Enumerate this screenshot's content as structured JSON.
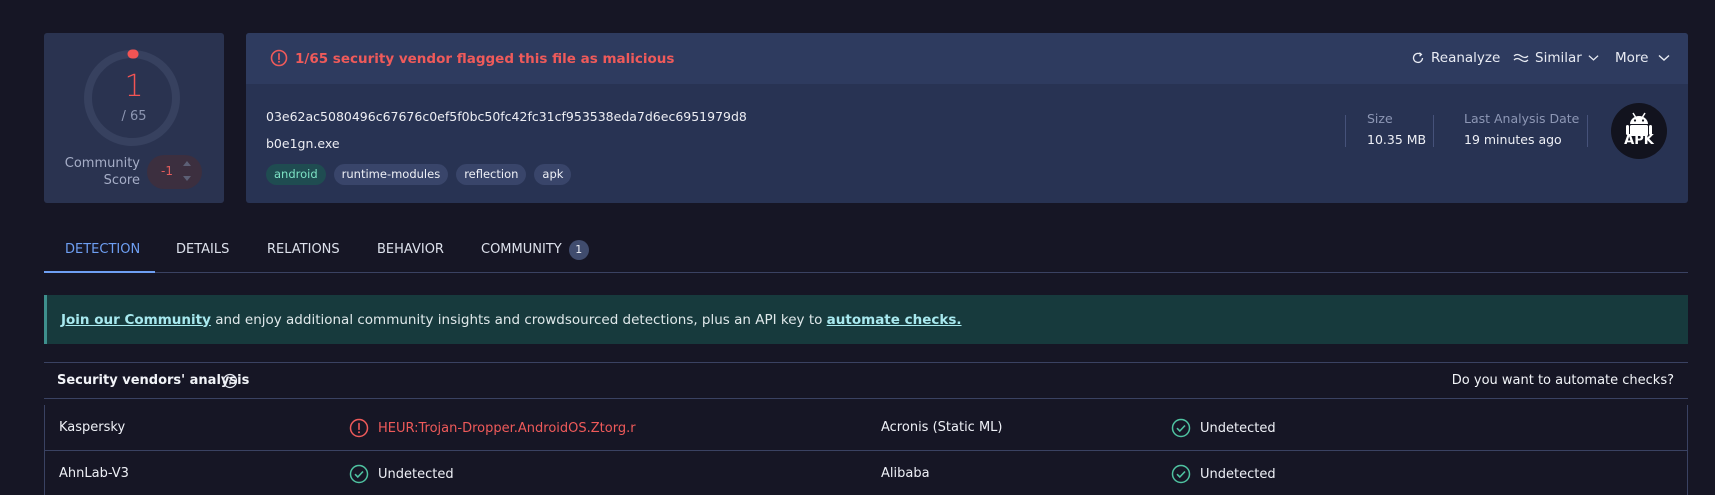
{
  "score": {
    "detections": "1",
    "total": "/ 65",
    "community_label": "Community Score",
    "community_value": "-1",
    "detection_fraction": 0.0154,
    "color": "#f25454"
  },
  "file": {
    "flag_message": "1/65 security vendor flagged this file as malicious",
    "hash": "03e62ac5080496c67676c0ef5f0bc50fc42fc31cf953538eda7d6ec6951979d8",
    "name": "b0e1gn.exe",
    "tags": [
      "android",
      "runtime-modules",
      "reflection",
      "apk"
    ],
    "size_label": "Size",
    "size_value": "10.35 MB",
    "date_label": "Last Analysis Date",
    "date_value": "19 minutes ago",
    "type_icon_label": "APK"
  },
  "actions": {
    "reanalyze": "Reanalyze",
    "similar": "Similar",
    "more": "More"
  },
  "tabs": [
    {
      "label": "DETECTION",
      "active": true
    },
    {
      "label": "DETAILS"
    },
    {
      "label": "RELATIONS"
    },
    {
      "label": "BEHAVIOR"
    },
    {
      "label": "COMMUNITY",
      "badge": "1"
    }
  ],
  "banner": {
    "link1": "Join our Community",
    "middle": " and enjoy additional community insights and crowdsourced detections, plus an API key to ",
    "link2": "automate checks."
  },
  "vendors": {
    "title": "Security vendors' analysis",
    "automate_prompt": "Do you want to automate checks?",
    "rows": [
      {
        "left": {
          "name": "Kaspersky",
          "result": "HEUR:Trojan-Dropper.AndroidOS.Ztorg.r",
          "status": "malicious"
        },
        "right": {
          "name": "Acronis (Static ML)",
          "result": "Undetected",
          "status": "clean"
        }
      },
      {
        "left": {
          "name": "AhnLab-V3",
          "result": "Undetected",
          "status": "clean"
        },
        "right": {
          "name": "Alibaba",
          "result": "Undetected",
          "status": "clean"
        }
      }
    ]
  },
  "colors": {
    "malicious": "#ef5a5a",
    "clean": "#4fc3a1",
    "accent": "#6e9ff3"
  }
}
